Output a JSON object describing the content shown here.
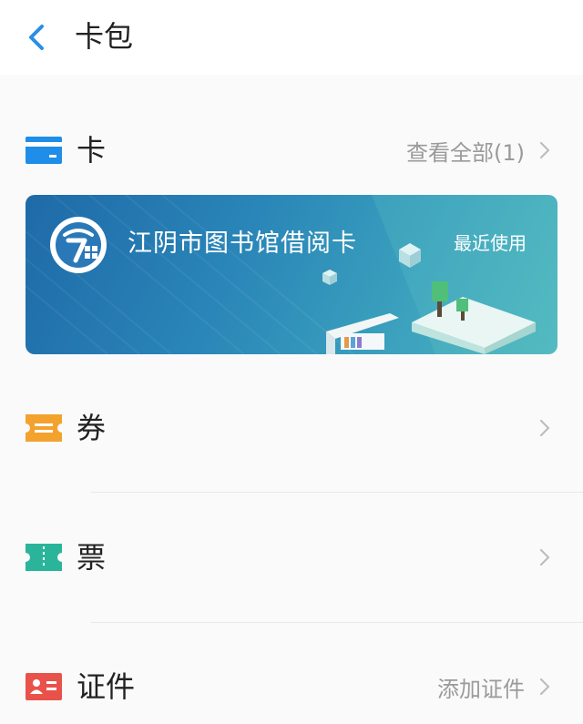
{
  "header": {
    "title": "卡包",
    "back_icon": "chevron-left-icon"
  },
  "sections": {
    "cards": {
      "label": "卡",
      "link": "查看全部(1)",
      "icon": "card-icon",
      "icon_color": "#1f8ee8"
    },
    "coupons": {
      "label": "券",
      "icon": "coupon-icon",
      "icon_color": "#f3a22e"
    },
    "tickets": {
      "label": "票",
      "icon": "ticket-icon",
      "icon_color": "#2ab59b"
    },
    "ids": {
      "label": "证件",
      "link": "添加证件",
      "icon": "id-card-icon",
      "icon_color": "#e9524a"
    }
  },
  "library_card": {
    "name": "江阴市图书馆借阅卡",
    "tag": "最近使用",
    "logo": "library-logo-icon"
  },
  "colors": {
    "accent": "#2a8ee6",
    "muted_text": "#9a9a9a",
    "chevron": "#bdbdbd"
  }
}
